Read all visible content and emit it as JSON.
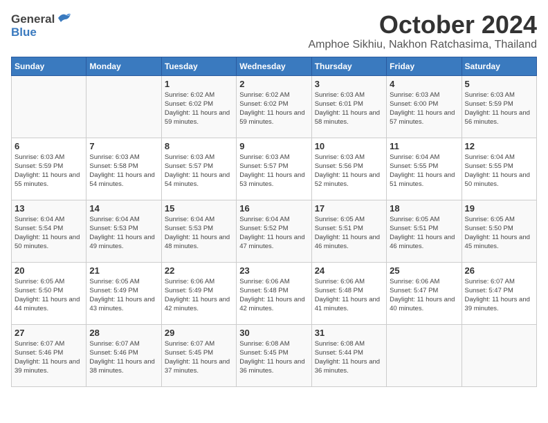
{
  "header": {
    "logo_general": "General",
    "logo_blue": "Blue",
    "month_title": "October 2024",
    "subtitle": "Amphoe Sikhiu, Nakhon Ratchasima, Thailand"
  },
  "weekdays": [
    "Sunday",
    "Monday",
    "Tuesday",
    "Wednesday",
    "Thursday",
    "Friday",
    "Saturday"
  ],
  "weeks": [
    [
      {
        "day": "",
        "detail": ""
      },
      {
        "day": "",
        "detail": ""
      },
      {
        "day": "1",
        "detail": "Sunrise: 6:02 AM\nSunset: 6:02 PM\nDaylight: 11 hours and 59 minutes."
      },
      {
        "day": "2",
        "detail": "Sunrise: 6:02 AM\nSunset: 6:02 PM\nDaylight: 11 hours and 59 minutes."
      },
      {
        "day": "3",
        "detail": "Sunrise: 6:03 AM\nSunset: 6:01 PM\nDaylight: 11 hours and 58 minutes."
      },
      {
        "day": "4",
        "detail": "Sunrise: 6:03 AM\nSunset: 6:00 PM\nDaylight: 11 hours and 57 minutes."
      },
      {
        "day": "5",
        "detail": "Sunrise: 6:03 AM\nSunset: 5:59 PM\nDaylight: 11 hours and 56 minutes."
      }
    ],
    [
      {
        "day": "6",
        "detail": "Sunrise: 6:03 AM\nSunset: 5:59 PM\nDaylight: 11 hours and 55 minutes."
      },
      {
        "day": "7",
        "detail": "Sunrise: 6:03 AM\nSunset: 5:58 PM\nDaylight: 11 hours and 54 minutes."
      },
      {
        "day": "8",
        "detail": "Sunrise: 6:03 AM\nSunset: 5:57 PM\nDaylight: 11 hours and 54 minutes."
      },
      {
        "day": "9",
        "detail": "Sunrise: 6:03 AM\nSunset: 5:57 PM\nDaylight: 11 hours and 53 minutes."
      },
      {
        "day": "10",
        "detail": "Sunrise: 6:03 AM\nSunset: 5:56 PM\nDaylight: 11 hours and 52 minutes."
      },
      {
        "day": "11",
        "detail": "Sunrise: 6:04 AM\nSunset: 5:55 PM\nDaylight: 11 hours and 51 minutes."
      },
      {
        "day": "12",
        "detail": "Sunrise: 6:04 AM\nSunset: 5:55 PM\nDaylight: 11 hours and 50 minutes."
      }
    ],
    [
      {
        "day": "13",
        "detail": "Sunrise: 6:04 AM\nSunset: 5:54 PM\nDaylight: 11 hours and 50 minutes."
      },
      {
        "day": "14",
        "detail": "Sunrise: 6:04 AM\nSunset: 5:53 PM\nDaylight: 11 hours and 49 minutes."
      },
      {
        "day": "15",
        "detail": "Sunrise: 6:04 AM\nSunset: 5:53 PM\nDaylight: 11 hours and 48 minutes."
      },
      {
        "day": "16",
        "detail": "Sunrise: 6:04 AM\nSunset: 5:52 PM\nDaylight: 11 hours and 47 minutes."
      },
      {
        "day": "17",
        "detail": "Sunrise: 6:05 AM\nSunset: 5:51 PM\nDaylight: 11 hours and 46 minutes."
      },
      {
        "day": "18",
        "detail": "Sunrise: 6:05 AM\nSunset: 5:51 PM\nDaylight: 11 hours and 46 minutes."
      },
      {
        "day": "19",
        "detail": "Sunrise: 6:05 AM\nSunset: 5:50 PM\nDaylight: 11 hours and 45 minutes."
      }
    ],
    [
      {
        "day": "20",
        "detail": "Sunrise: 6:05 AM\nSunset: 5:50 PM\nDaylight: 11 hours and 44 minutes."
      },
      {
        "day": "21",
        "detail": "Sunrise: 6:05 AM\nSunset: 5:49 PM\nDaylight: 11 hours and 43 minutes."
      },
      {
        "day": "22",
        "detail": "Sunrise: 6:06 AM\nSunset: 5:49 PM\nDaylight: 11 hours and 42 minutes."
      },
      {
        "day": "23",
        "detail": "Sunrise: 6:06 AM\nSunset: 5:48 PM\nDaylight: 11 hours and 42 minutes."
      },
      {
        "day": "24",
        "detail": "Sunrise: 6:06 AM\nSunset: 5:48 PM\nDaylight: 11 hours and 41 minutes."
      },
      {
        "day": "25",
        "detail": "Sunrise: 6:06 AM\nSunset: 5:47 PM\nDaylight: 11 hours and 40 minutes."
      },
      {
        "day": "26",
        "detail": "Sunrise: 6:07 AM\nSunset: 5:47 PM\nDaylight: 11 hours and 39 minutes."
      }
    ],
    [
      {
        "day": "27",
        "detail": "Sunrise: 6:07 AM\nSunset: 5:46 PM\nDaylight: 11 hours and 39 minutes."
      },
      {
        "day": "28",
        "detail": "Sunrise: 6:07 AM\nSunset: 5:46 PM\nDaylight: 11 hours and 38 minutes."
      },
      {
        "day": "29",
        "detail": "Sunrise: 6:07 AM\nSunset: 5:45 PM\nDaylight: 11 hours and 37 minutes."
      },
      {
        "day": "30",
        "detail": "Sunrise: 6:08 AM\nSunset: 5:45 PM\nDaylight: 11 hours and 36 minutes."
      },
      {
        "day": "31",
        "detail": "Sunrise: 6:08 AM\nSunset: 5:44 PM\nDaylight: 11 hours and 36 minutes."
      },
      {
        "day": "",
        "detail": ""
      },
      {
        "day": "",
        "detail": ""
      }
    ]
  ]
}
